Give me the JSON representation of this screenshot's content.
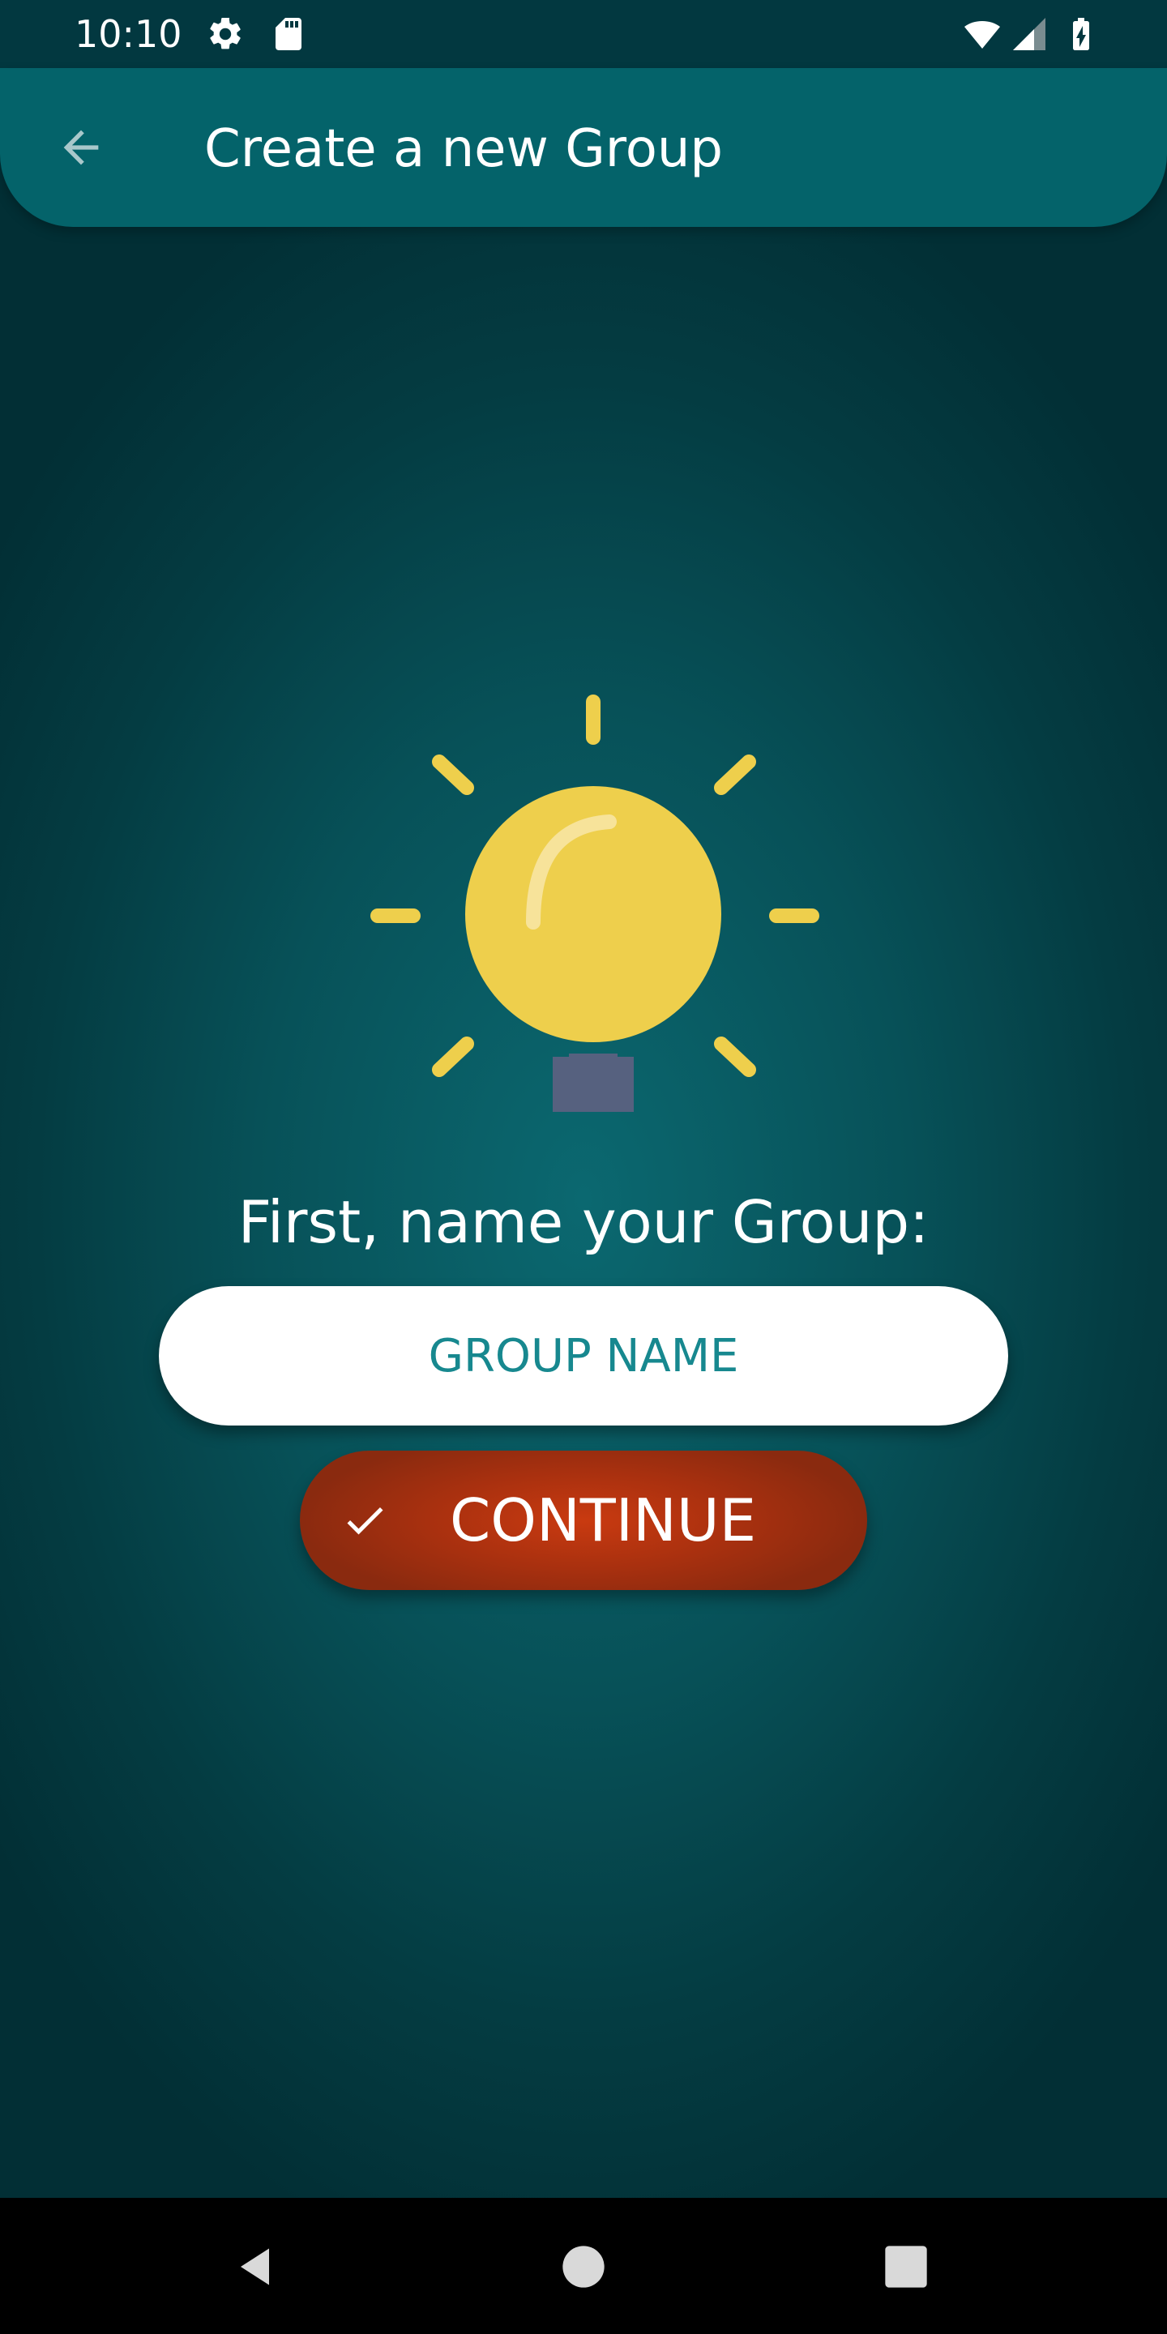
{
  "status_bar": {
    "time": "10:10",
    "icons": [
      "settings-icon",
      "sd-card-icon",
      "wifi-icon",
      "cell-signal-icon",
      "battery-charging-icon"
    ]
  },
  "app_bar": {
    "back_icon": "arrow-left-icon",
    "title": "Create a new Group",
    "background_color": "#04636a"
  },
  "main": {
    "illustration": "lightbulb-icon",
    "prompt": "First, name your Group:",
    "group_name_input": {
      "value": "",
      "placeholder": "GROUP NAME"
    },
    "continue_button": {
      "icon": "check-icon",
      "label": "CONTINUE",
      "color": "#b5330f"
    }
  },
  "nav_bar": {
    "buttons": [
      "back-triangle-icon",
      "home-circle-icon",
      "recents-square-icon"
    ]
  },
  "colors": {
    "background": "#075158",
    "bulb": "#eecf4c",
    "bulb_base": "#56617f",
    "input_text": "#17888f"
  }
}
